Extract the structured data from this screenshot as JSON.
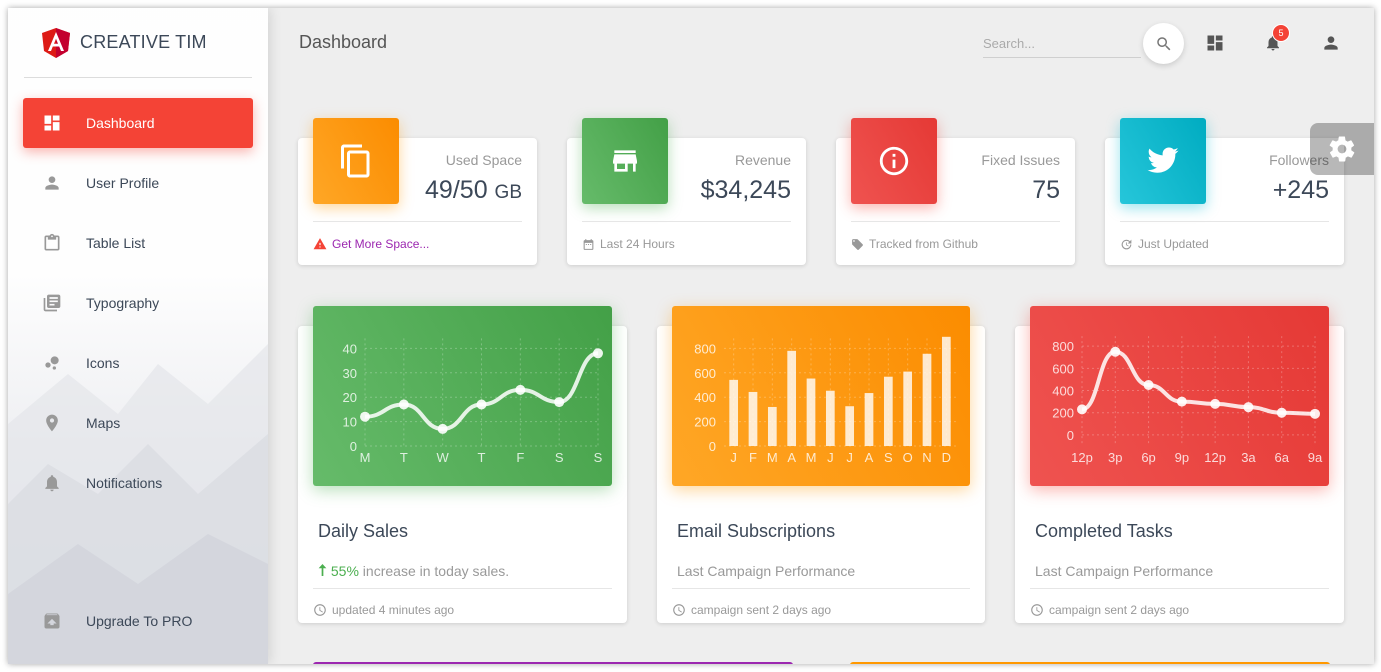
{
  "brand": {
    "name": "CREATIVE TIM",
    "logo_icon": "angular-logo-icon",
    "logo_color": "#dd1b16"
  },
  "sidebar": {
    "items": [
      {
        "label": "Dashboard",
        "icon": "dashboard-icon",
        "active": true
      },
      {
        "label": "User Profile",
        "icon": "person-icon"
      },
      {
        "label": "Table List",
        "icon": "clipboard-icon"
      },
      {
        "label": "Typography",
        "icon": "library-books-icon"
      },
      {
        "label": "Icons",
        "icon": "bubble-chart-icon"
      },
      {
        "label": "Maps",
        "icon": "location-pin-icon"
      },
      {
        "label": "Notifications",
        "icon": "bell-icon"
      }
    ],
    "upgrade": {
      "label": "Upgrade To PRO",
      "icon": "unarchive-icon"
    }
  },
  "header": {
    "title": "Dashboard",
    "search_placeholder": "Search...",
    "notification_count": "5"
  },
  "stats": [
    {
      "category": "Used Space",
      "value": "49/50",
      "unit": "GB",
      "footer": "Get More Space...",
      "footer_icon": "warning-icon",
      "color": "#ff9800"
    },
    {
      "category": "Revenue",
      "value": "$34,245",
      "unit": "",
      "footer": "Last 24 Hours",
      "footer_icon": "calendar-icon",
      "color": "#4caf50"
    },
    {
      "category": "Fixed Issues",
      "value": "75",
      "unit": "",
      "footer": "Tracked from Github",
      "footer_icon": "tag-icon",
      "color": "#f44336"
    },
    {
      "category": "Followers",
      "value": "+245",
      "unit": "",
      "footer": "Just Updated",
      "footer_icon": "update-icon",
      "color": "#00bcd4"
    }
  ],
  "charts": [
    {
      "title": "Daily Sales",
      "category_pct": "55%",
      "category_rest": " increase in today sales.",
      "footer": "updated 4 minutes ago",
      "color": "#4caf50"
    },
    {
      "title": "Email Subscriptions",
      "category": "Last Campaign Performance",
      "footer": "campaign sent 2 days ago",
      "color": "#ff9800"
    },
    {
      "title": "Completed Tasks",
      "category": "Last Campaign Performance",
      "footer": "campaign sent 2 days ago",
      "color": "#f44336"
    }
  ],
  "chart_data": [
    {
      "type": "line",
      "categories": [
        "M",
        "T",
        "W",
        "T",
        "F",
        "S",
        "S"
      ],
      "values": [
        12,
        17,
        7,
        17,
        23,
        18,
        38
      ],
      "yticks": [
        0,
        10,
        20,
        30,
        40
      ],
      "ylim": [
        0,
        50
      ],
      "grid": true
    },
    {
      "type": "bar",
      "categories": [
        "J",
        "F",
        "M",
        "A",
        "M",
        "J",
        "J",
        "A",
        "S",
        "O",
        "N",
        "D"
      ],
      "values": [
        542,
        443,
        320,
        780,
        553,
        453,
        326,
        434,
        568,
        610,
        756,
        895
      ],
      "yticks": [
        0,
        200,
        400,
        600,
        800
      ],
      "ylim": [
        0,
        1000
      ],
      "grid": true
    },
    {
      "type": "line",
      "categories": [
        "12p",
        "3p",
        "6p",
        "9p",
        "12p",
        "3a",
        "6a",
        "9a"
      ],
      "values": [
        230,
        750,
        450,
        300,
        280,
        250,
        200,
        190
      ],
      "yticks": [
        0,
        200,
        400,
        600,
        800
      ],
      "ylim": [
        -100,
        1000
      ],
      "grid": true
    }
  ]
}
